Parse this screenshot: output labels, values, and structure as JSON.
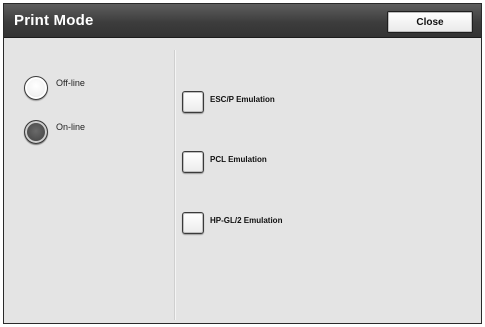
{
  "window": {
    "title": "Print Mode",
    "close_label": "Close"
  },
  "status": {
    "options": [
      {
        "label": "Off-line",
        "selected": false
      },
      {
        "label": "On-line",
        "selected": true
      }
    ]
  },
  "emulations": {
    "items": [
      {
        "label": "ESC/P Emulation"
      },
      {
        "label": "PCL Emulation"
      },
      {
        "label": "HP-GL/2 Emulation"
      }
    ]
  }
}
